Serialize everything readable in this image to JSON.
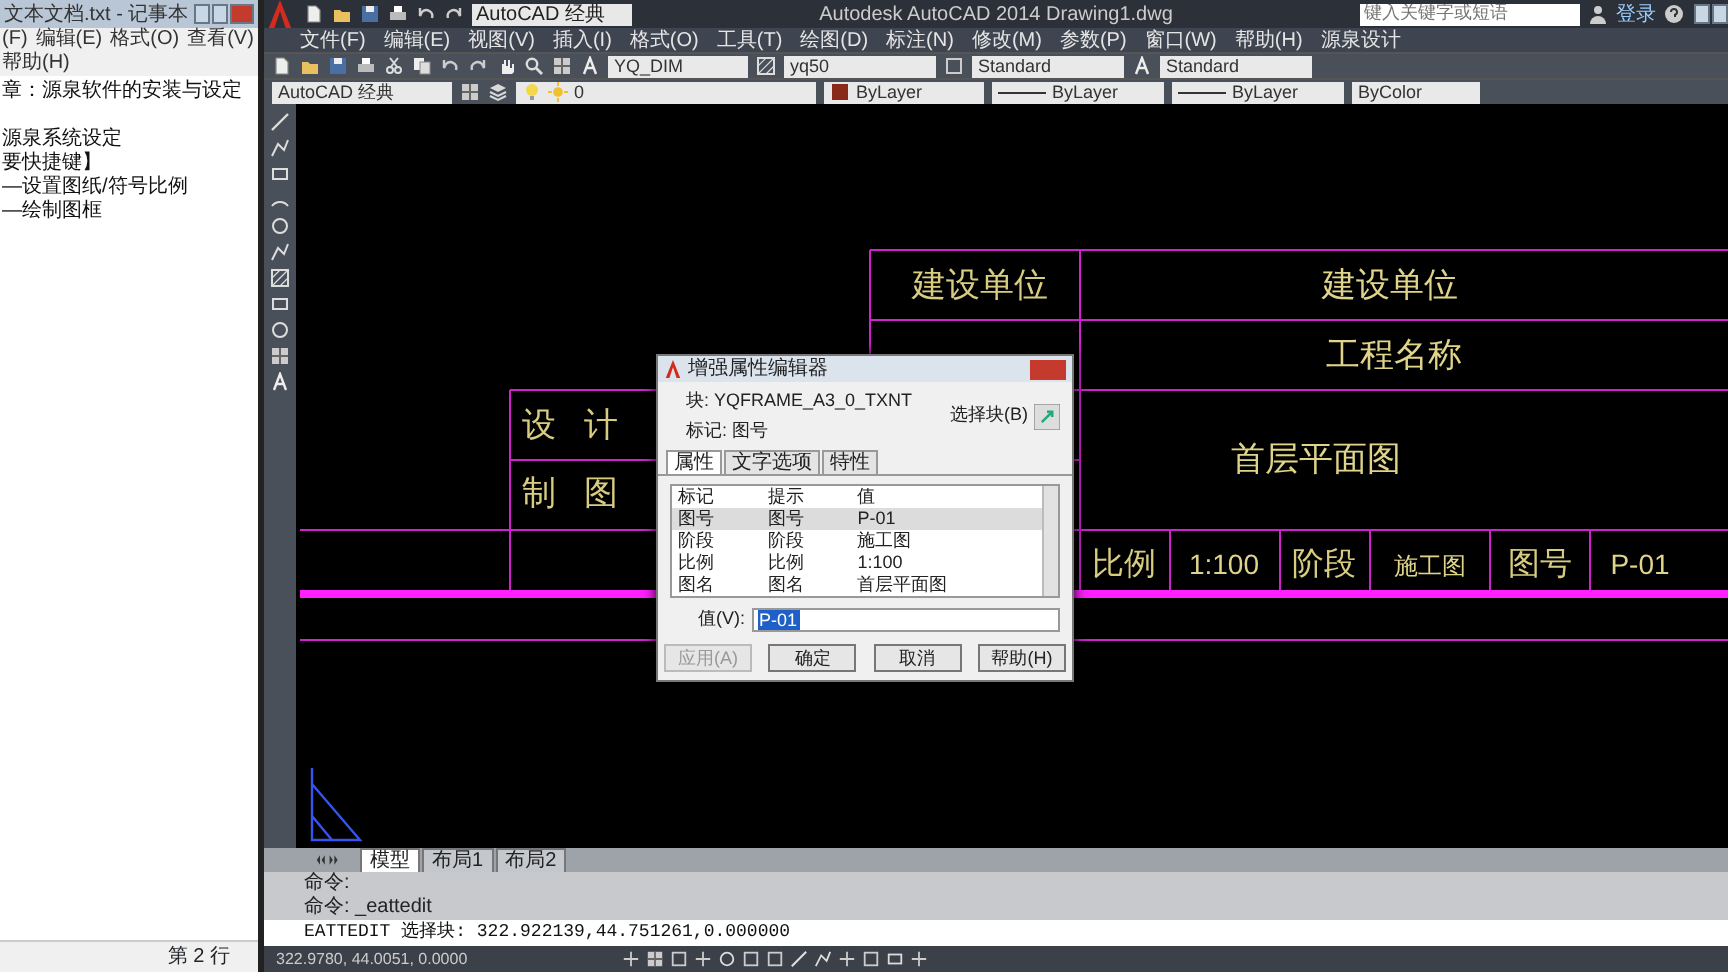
{
  "notepad": {
    "title": "文本文档.txt - 记事本",
    "menu": [
      "(F)",
      "编辑(E)",
      "格式(O)",
      "查看(V)",
      "帮助(H)"
    ],
    "lines": [
      "章：源泉软件的安装与设定",
      "源泉系统设定",
      "要快捷键】",
      "—设置图纸/符号比例",
      "—绘制图框"
    ],
    "status": "第 2 行"
  },
  "autocad": {
    "workspace": "AutoCAD 经典",
    "title": "Autodesk AutoCAD 2014",
    "document": "Drawing1.dwg",
    "search": {
      "placeholder": "键入关键字或短语"
    },
    "login": "登录",
    "menu": [
      "文件(F)",
      "编辑(E)",
      "视图(V)",
      "插入(I)",
      "格式(O)",
      "工具(T)",
      "绘图(D)",
      "标注(N)",
      "修改(M)",
      "参数(P)",
      "窗口(W)",
      "帮助(H)",
      "源泉设计"
    ],
    "style_dropdowns": [
      "YQ_DIM",
      "yq50",
      "Standard",
      "Standard"
    ],
    "property_dropdowns": [
      {
        "kind": "workspace",
        "value": "AutoCAD 经典"
      },
      {
        "kind": "layer",
        "value": "0"
      },
      {
        "kind": "color",
        "value": "ByLayer"
      },
      {
        "kind": "linetype",
        "value": "ByLayer"
      },
      {
        "kind": "lineweight",
        "value": "ByLayer"
      },
      {
        "kind": "plotstyle",
        "value": "ByColor"
      }
    ]
  },
  "drawing": {
    "title_block": [
      {
        "kind": "label",
        "text": "建设单位"
      },
      {
        "kind": "value",
        "text": "建设单位"
      },
      {
        "kind": "value",
        "text": "工程名称"
      },
      {
        "kind": "label",
        "text": "设计"
      },
      {
        "kind": "label",
        "text": "制图"
      },
      {
        "kind": "value",
        "text": "首层平面图"
      },
      {
        "kind": "label",
        "text": "比例"
      },
      {
        "kind": "value",
        "text": "1:100"
      },
      {
        "kind": "label",
        "text": "阶段"
      },
      {
        "kind": "value",
        "text": "施工图"
      },
      {
        "kind": "label",
        "text": "图号"
      },
      {
        "kind": "value",
        "text": "P-01"
      }
    ]
  },
  "dialog": {
    "title": "增强属性编辑器",
    "block_label": "块:",
    "block": "YQFRAME_A3_0_TXNT",
    "tag_label": "标记:",
    "tag": "图号",
    "select_button": "选择块(B)",
    "tabs": [
      {
        "label": "属性",
        "selected": true
      },
      {
        "label": "文字选项",
        "selected": false
      },
      {
        "label": "特性",
        "selected": false
      }
    ],
    "columns": [
      "标记",
      "提示",
      "值"
    ],
    "rows": [
      {
        "cells": [
          "图号",
          "图号",
          "P-01"
        ],
        "selected": true
      },
      {
        "cells": [
          "阶段",
          "阶段",
          "施工图"
        ],
        "selected": false
      },
      {
        "cells": [
          "比例",
          "比例",
          "1:100"
        ],
        "selected": false
      },
      {
        "cells": [
          "图名",
          "图名",
          "首层平面图"
        ],
        "selected": false
      }
    ],
    "value_label": "值(V):",
    "value": "P-01",
    "buttons": [
      {
        "label": "应用(A)",
        "disabled": true
      },
      {
        "label": "确定",
        "disabled": false
      },
      {
        "label": "取消",
        "disabled": false
      },
      {
        "label": "帮助(H)",
        "disabled": false
      }
    ]
  },
  "layout_tabs": [
    {
      "label": "模型",
      "selected": true
    },
    {
      "label": "布局1",
      "selected": false
    },
    {
      "label": "布局2",
      "selected": false
    }
  ],
  "command_history": [
    "命令:",
    "命令: _eattedit"
  ],
  "command_prompt": "EATTEDIT 选择块: 322.922139,44.751261,0.000000",
  "coordinates": "322.9780, 44.0051, 0.0000"
}
